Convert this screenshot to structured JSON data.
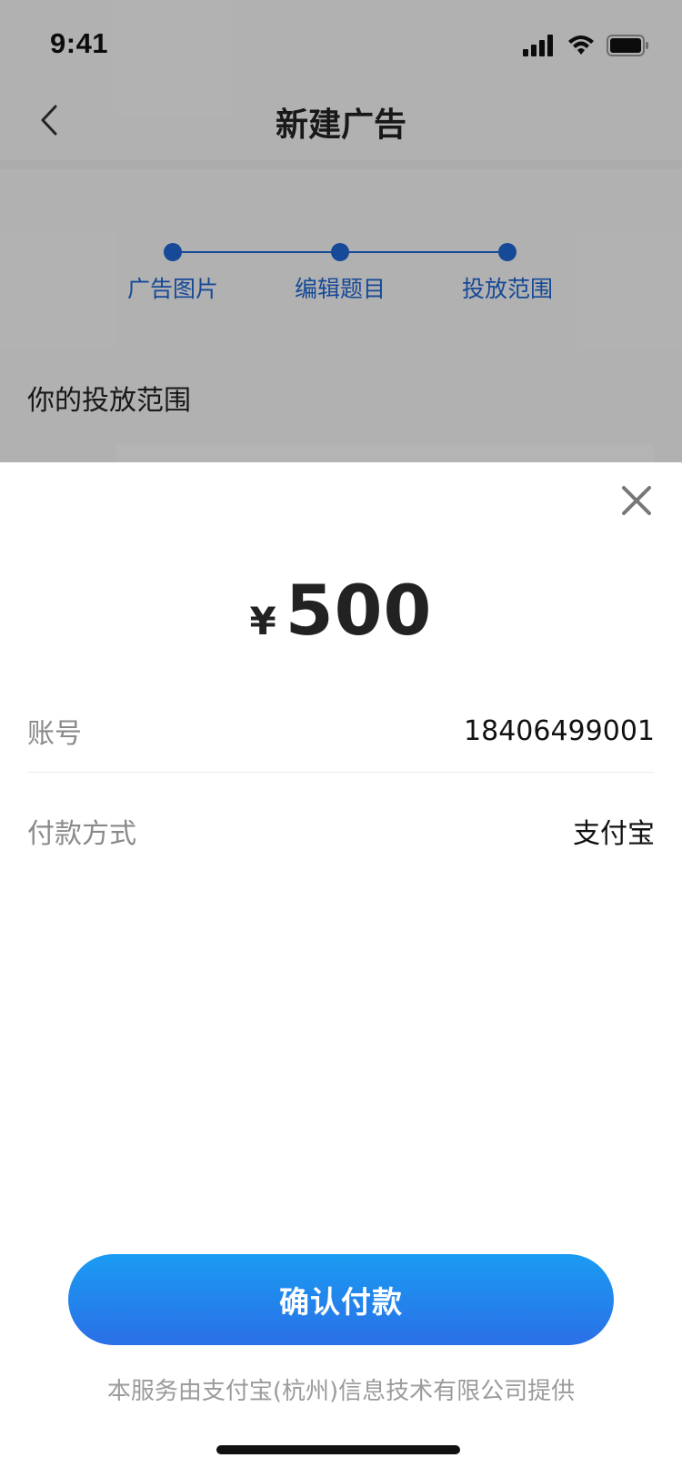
{
  "status_bar": {
    "time": "9:41"
  },
  "nav": {
    "title": "新建广告"
  },
  "steps": [
    {
      "label": "广告图片"
    },
    {
      "label": "编辑题目"
    },
    {
      "label": "投放范围"
    }
  ],
  "section": {
    "title": "你的投放范围"
  },
  "payment_sheet": {
    "currency_symbol": "¥",
    "amount": "500",
    "rows": [
      {
        "label": "账号",
        "value": "18406499001"
      },
      {
        "label": "付款方式",
        "value": "支付宝"
      }
    ],
    "confirm_label": "确认付款",
    "footnote": "本服务由支付宝(杭州)信息技术有限公司提供"
  },
  "colors": {
    "accent": "#1f66d1",
    "button_top": "#1a9cf3",
    "button_bottom": "#2a6fe6"
  },
  "icons": {
    "back": "chevron-left-icon",
    "close": "close-icon",
    "signal": "signal-icon",
    "wifi": "wifi-icon",
    "battery": "battery-icon"
  }
}
